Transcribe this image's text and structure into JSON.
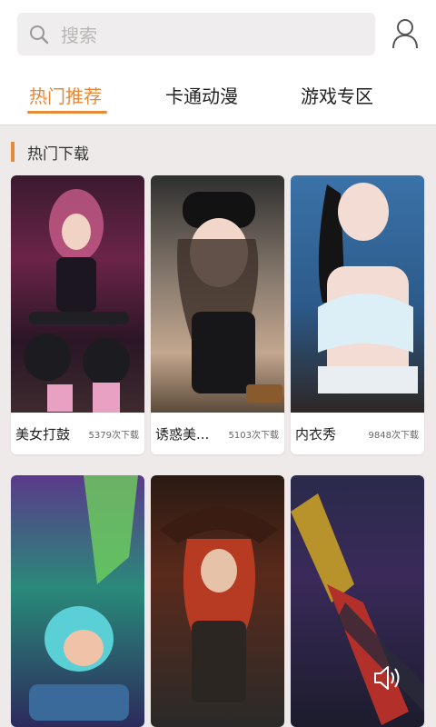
{
  "search": {
    "placeholder": "搜索"
  },
  "tabs": [
    {
      "label": "热门推荐",
      "active": true
    },
    {
      "label": "卡通动漫",
      "active": false
    },
    {
      "label": "游戏专区",
      "active": false
    }
  ],
  "section": {
    "title": "热门下载"
  },
  "cards_row1": [
    {
      "title": "美女打鼓",
      "count": "5379次下载"
    },
    {
      "title": "诱惑美...",
      "count": "5103次下载"
    },
    {
      "title": "内衣秀",
      "count": "9848次下载"
    }
  ],
  "colors": {
    "accent": "#e58a3a",
    "background": "#efeaea"
  },
  "icons": [
    "search-icon",
    "user-icon",
    "speaker-icon"
  ]
}
